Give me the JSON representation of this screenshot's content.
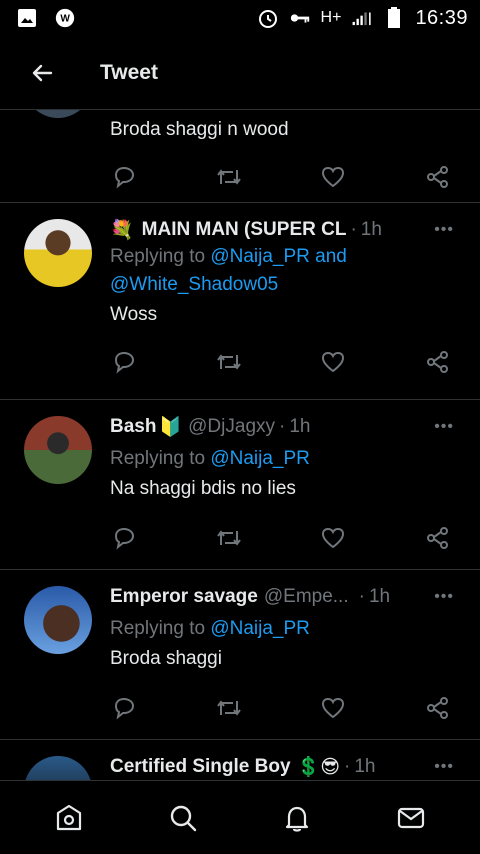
{
  "status_bar": {
    "time": "16:39",
    "network": "H+",
    "icons": [
      "gallery-icon",
      "app-notification-icon",
      "alarm-icon",
      "vpn-key-icon",
      "signal-icon",
      "battery-icon"
    ]
  },
  "header": {
    "title": "Tweet",
    "back_icon": "arrow-left-icon"
  },
  "tweets": [
    {
      "text": "Broda shaggi n wood"
    },
    {
      "name": "MAIN MAN (SUPER CL",
      "emoji": "💐",
      "time": "1h",
      "reply_prefix": "Replying to ",
      "reply_mention_1": "@Naija_PR",
      "reply_joiner": " and",
      "reply_mention_2": "@White_Shadow05",
      "text": "Woss"
    },
    {
      "name": "Bash",
      "emoji": "🔰",
      "handle": "@DjJagxy",
      "time": "1h",
      "reply_prefix": "Replying to ",
      "reply_mention_1": "@Naija_PR",
      "text": "Na shaggi bdis no lies"
    },
    {
      "name": "Emperor savage",
      "handle": "@Empe...",
      "time": "1h",
      "reply_prefix": "Replying to ",
      "reply_mention_1": "@Naija_PR",
      "text": "Broda shaggi"
    },
    {
      "name": "Certified Single Boy",
      "emoji": "💲😎",
      "time": "1h"
    }
  ],
  "dot_separator": "·",
  "more_label": "•••",
  "nav": [
    "home-icon",
    "search-icon",
    "notifications-icon",
    "messages-icon"
  ],
  "colors": {
    "background": "#000000",
    "text_primary": "#e7e9ea",
    "text_secondary": "#71767b",
    "link": "#1d9bf0",
    "divider": "#2f3336"
  }
}
